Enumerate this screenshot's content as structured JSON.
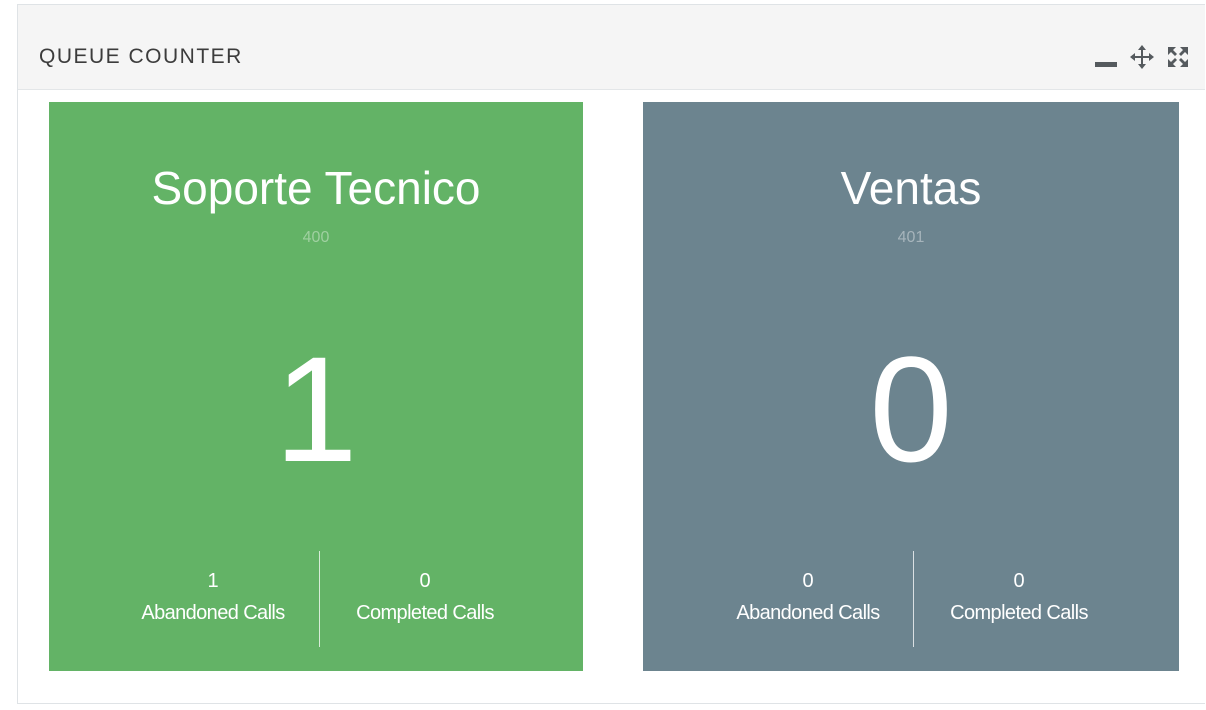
{
  "widget": {
    "title": "QUEUE COUNTER",
    "controls": [
      {
        "icon": "minimize-icon"
      },
      {
        "icon": "move-icon"
      },
      {
        "icon": "expand-icon"
      }
    ]
  },
  "colors": {
    "green_tile": "#63b366",
    "gray_tile": "#6c848f"
  },
  "queues": [
    {
      "name": "Soporte Tecnico",
      "extension": "400",
      "count": "1",
      "abandoned_value": "1",
      "abandoned_label": "Abandoned Calls",
      "completed_value": "0",
      "completed_label": "Completed Calls"
    },
    {
      "name": "Ventas",
      "extension": "401",
      "count": "0",
      "abandoned_value": "0",
      "abandoned_label": "Abandoned Calls",
      "completed_value": "0",
      "completed_label": "Completed Calls"
    }
  ]
}
